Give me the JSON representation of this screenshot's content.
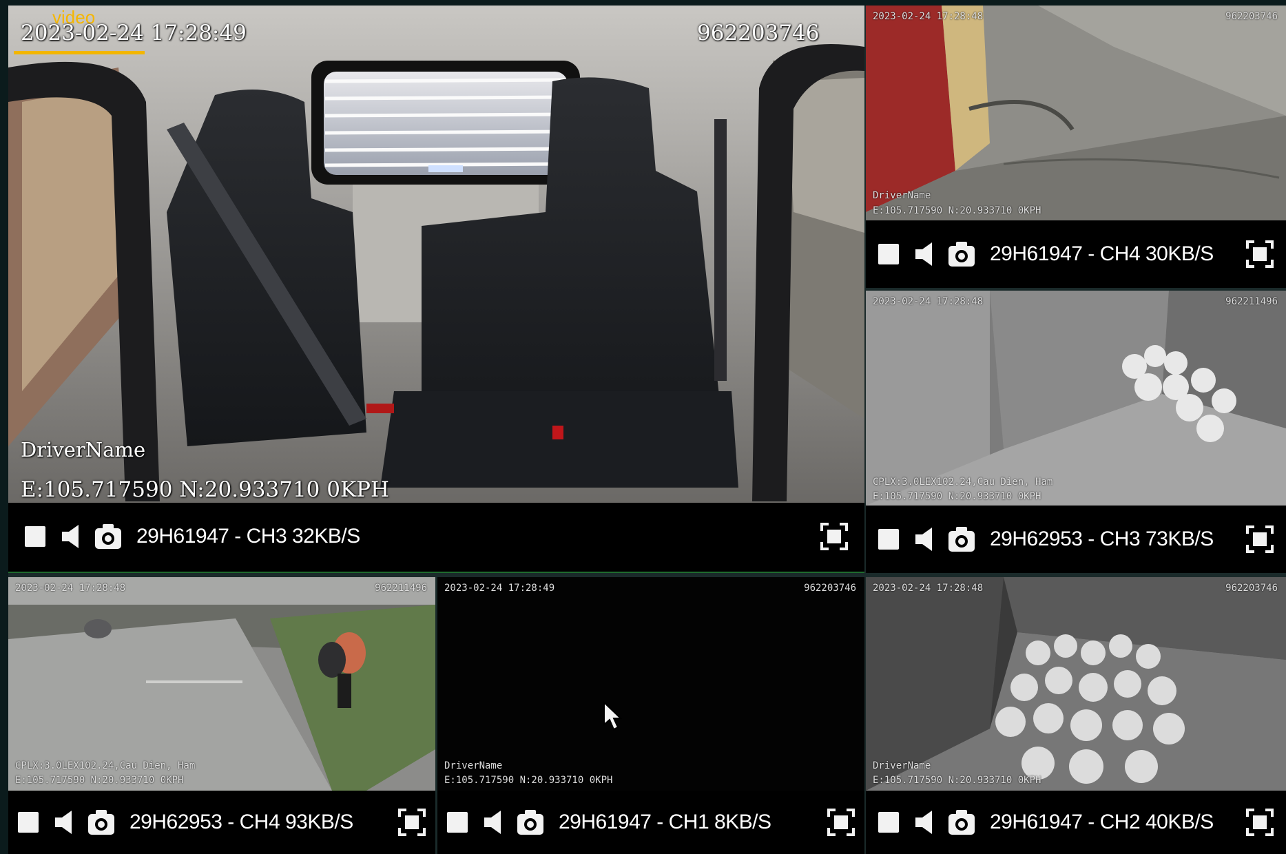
{
  "overlay_tag": "video",
  "colors": {
    "accent": "#f2b600",
    "panel_bg": "#000000",
    "border_green": "#1f6b2e"
  },
  "icons": {
    "stop": "stop-square-icon",
    "mute": "speaker-icon",
    "snapshot": "camera-icon",
    "fullscreen": "fullscreen-icon",
    "pointer": "mouse-pointer-icon"
  },
  "main": {
    "timestamp": "2023-02-24 17:28:49",
    "device_id": "962203746",
    "driver": "DriverName",
    "gps": "E:105.717590 N:20.933710 0KPH",
    "label": "29H61947 - CH3 32KB/S"
  },
  "tiles": [
    {
      "label": "29H61947 - CH4 30KB/S",
      "timestamp": "2023-02-24 17:28:48",
      "device_id": "962203746",
      "driver": "DriverName",
      "gps": "E:105.717590 N:20.933710 0KPH"
    },
    {
      "label": "29H62953 - CH3 73KB/S",
      "timestamp": "2023-02-24 17:28:48",
      "device_id": "962211496",
      "driver": "CPLX:3.0LEX102.24,Cau Dien, Ham",
      "gps": "E:105.717590 N:20.933710 0KPH"
    },
    {
      "label": "29H62953 - CH4 93KB/S",
      "timestamp": "2023-02-24 17:28:48",
      "device_id": "962211496",
      "driver": "CPLX:3.0LEX102.24,Cau Dien, Ham",
      "gps": "E:105.717590 N:20.933710 0KPH"
    },
    {
      "label": "29H61947 - CH1 8KB/S",
      "timestamp": "2023-02-24 17:28:49",
      "device_id": "962203746",
      "driver": "DriverName",
      "gps": "E:105.717590 N:20.933710 0KPH"
    },
    {
      "label": "29H61947 - CH2 40KB/S",
      "timestamp": "2023-02-24 17:28:48",
      "device_id": "962203746",
      "driver": "DriverName",
      "gps": "E:105.717590 N:20.933710 0KPH"
    }
  ]
}
